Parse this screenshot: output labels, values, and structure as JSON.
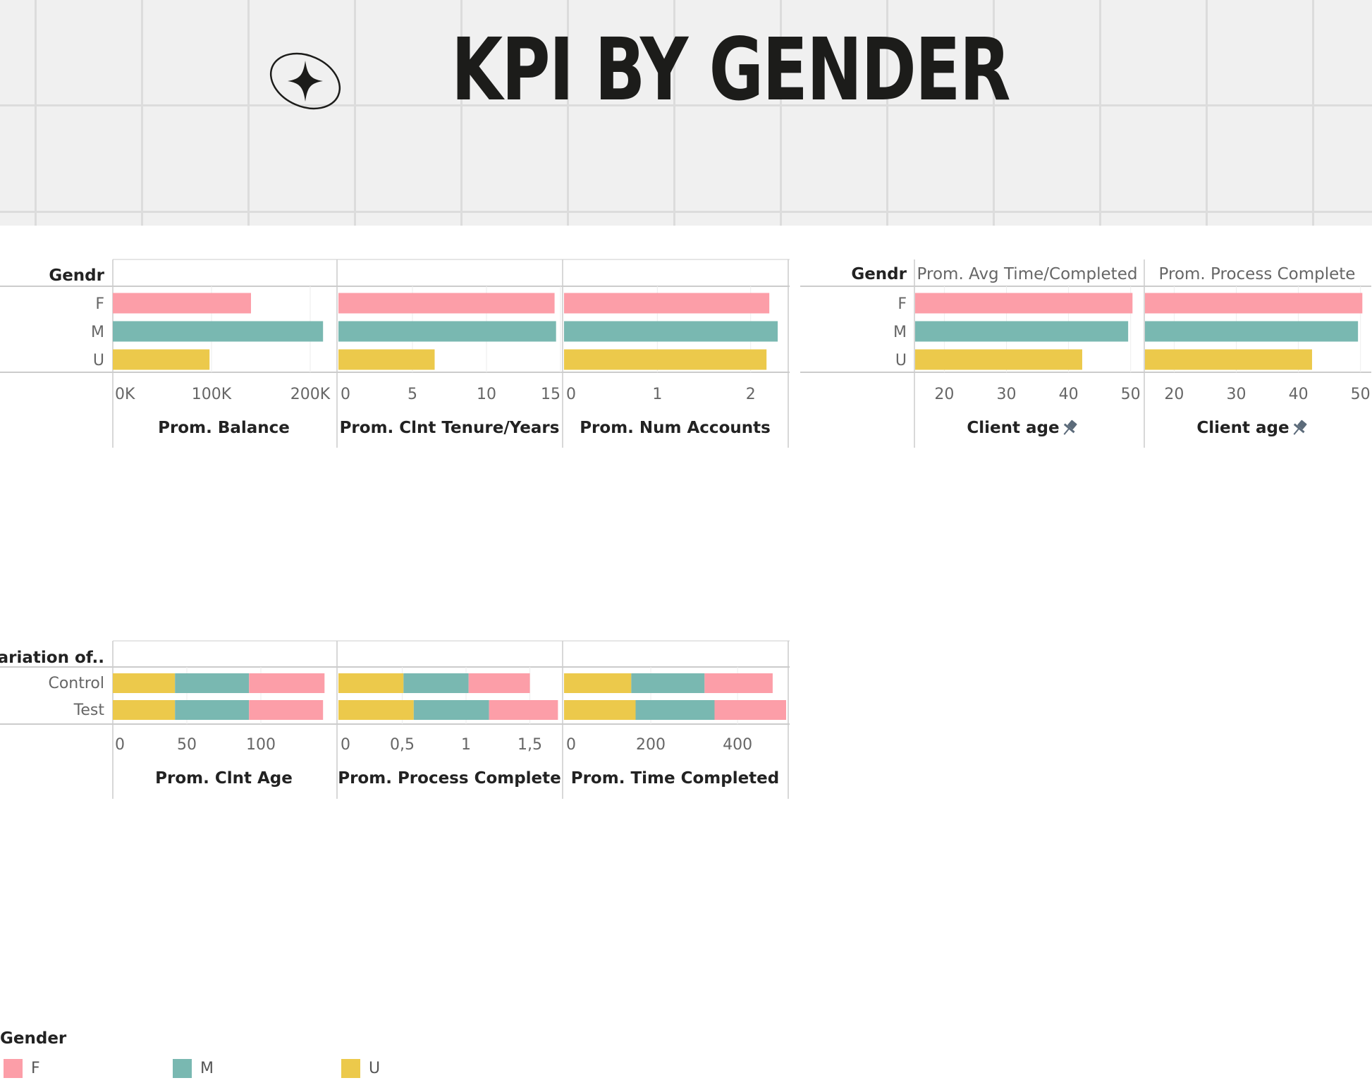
{
  "banner": {
    "title": "KPI BY GENDER"
  },
  "colors": {
    "F": "#fc9ea8",
    "M": "#79b8b1",
    "U": "#ecc94b"
  },
  "chart_data": [
    {
      "type": "bar",
      "orientation": "horizontal",
      "row_header": "Gendr",
      "categories": [
        "F",
        "M",
        "U"
      ],
      "panels": [
        {
          "measure": "Prom. Balance",
          "values": [
            140000,
            213000,
            98000
          ],
          "xlim": [
            0,
            225000
          ],
          "ticks": [
            0,
            100000,
            200000
          ],
          "tick_labels": [
            "0K",
            "100K",
            "200K"
          ]
        },
        {
          "measure": "Prom. Clnt Tenure/Years",
          "values": [
            14.6,
            14.7,
            6.5
          ],
          "xlim": [
            0,
            15
          ],
          "ticks": [
            0,
            5,
            10,
            15
          ],
          "tick_labels": [
            "0",
            "5",
            "10",
            "15"
          ]
        },
        {
          "measure": "Prom. Num Accounts",
          "values": [
            2.2,
            2.29,
            2.17
          ],
          "xlim": [
            0,
            2.38
          ],
          "ticks": [
            0,
            1,
            2
          ],
          "tick_labels": [
            "0",
            "1",
            "2"
          ]
        }
      ]
    },
    {
      "type": "bar",
      "orientation": "horizontal",
      "row_header": "Gendr",
      "categories": [
        "F",
        "M",
        "U"
      ],
      "panels": [
        {
          "column_header": "Prom. Avg Time/Completed",
          "axis_title": "Client age",
          "values": [
            50.3,
            49.6,
            42.2
          ],
          "xlim": [
            15.3,
            51.4
          ],
          "ticks": [
            20,
            30,
            40,
            50
          ],
          "tick_labels": [
            "20",
            "30",
            "40",
            "50"
          ]
        },
        {
          "column_header": "Prom. Process Complete",
          "axis_title": "Client age",
          "values": [
            50.3,
            49.6,
            42.2
          ],
          "xlim": [
            15.3,
            51.4
          ],
          "ticks": [
            20,
            30,
            40,
            50
          ],
          "tick_labels": [
            "20",
            "30",
            "40",
            "50"
          ]
        }
      ]
    },
    {
      "type": "bar",
      "orientation": "horizontal",
      "stacked": true,
      "row_header": "Variation of..",
      "categories": [
        "Control",
        "Test"
      ],
      "stack_order": [
        "U",
        "M",
        "F"
      ],
      "panels": [
        {
          "measure": "Prom. Clnt Age",
          "series": [
            {
              "name": "U",
              "values": [
                42,
                42
              ]
            },
            {
              "name": "M",
              "values": [
                50,
                50
              ]
            },
            {
              "name": "F",
              "values": [
                51,
                50
              ]
            }
          ],
          "xlim": [
            0,
            150
          ],
          "ticks": [
            0,
            50,
            100
          ],
          "tick_labels": [
            "0",
            "50",
            "100"
          ]
        },
        {
          "measure": "Prom. Process Complete",
          "series": [
            {
              "name": "U",
              "values": [
                0.51,
                0.59
              ]
            },
            {
              "name": "M",
              "values": [
                0.51,
                0.59
              ]
            },
            {
              "name": "F",
              "values": [
                0.48,
                0.54
              ]
            }
          ],
          "xlim": [
            0,
            1.74
          ],
          "ticks": [
            0,
            0.5,
            1,
            1.5
          ],
          "tick_labels": [
            "0",
            "0,5",
            "1",
            "1,5"
          ]
        },
        {
          "measure": "Prom. Time Completed",
          "series": [
            {
              "name": "U",
              "values": [
                155,
                165
              ]
            },
            {
              "name": "M",
              "values": [
                169,
                182
              ]
            },
            {
              "name": "F",
              "values": [
                157,
                165
              ]
            }
          ],
          "xlim": [
            0,
            512
          ],
          "ticks": [
            0,
            200,
            400
          ],
          "tick_labels": [
            "0",
            "200",
            "400"
          ]
        }
      ]
    }
  ],
  "legend": {
    "title": "Gender",
    "items": [
      {
        "key": "F",
        "label": "F"
      },
      {
        "key": "M",
        "label": "M"
      },
      {
        "key": "U",
        "label": "U"
      }
    ]
  }
}
